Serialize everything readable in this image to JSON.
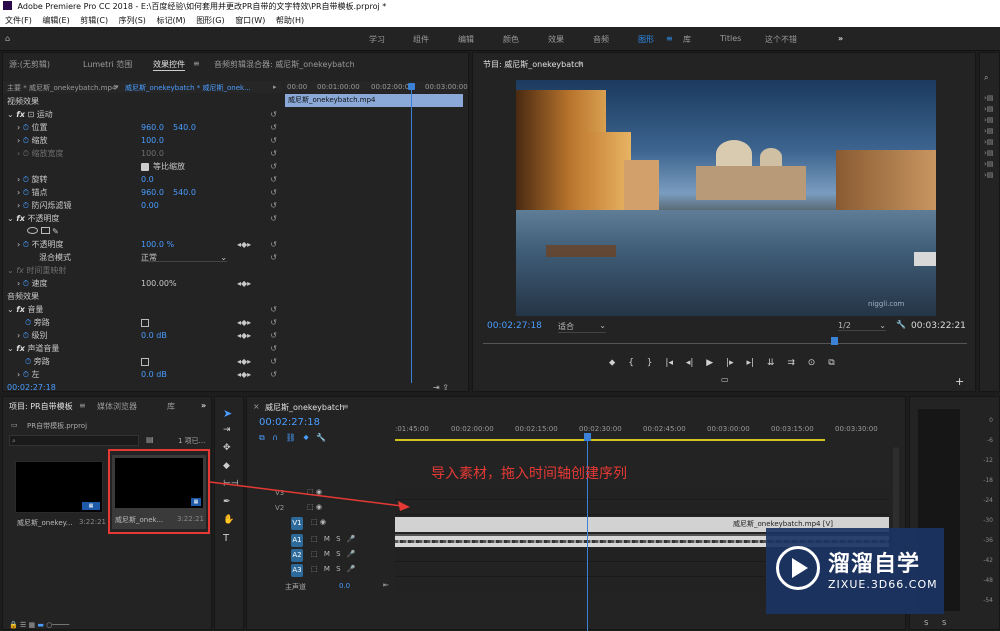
{
  "app": {
    "title": "Adobe Premiere Pro CC 2018 - E:\\百度经验\\如何套用并更改PR自带的文字特效\\PR自带模板.prproj *"
  },
  "menu": [
    "文件(F)",
    "编辑(E)",
    "剪辑(C)",
    "序列(S)",
    "标记(M)",
    "图形(G)",
    "窗口(W)",
    "帮助(H)"
  ],
  "workspaces": [
    {
      "label": "学习",
      "active": false
    },
    {
      "label": "组件",
      "active": false
    },
    {
      "label": "编辑",
      "active": false
    },
    {
      "label": "颜色",
      "active": false
    },
    {
      "label": "效果",
      "active": false
    },
    {
      "label": "音频",
      "active": false
    },
    {
      "label": "图形",
      "active": true
    },
    {
      "label": "库",
      "active": false
    },
    {
      "label": "Titles",
      "active": false
    },
    {
      "label": "这个不错",
      "active": false
    }
  ],
  "ws_more": "»",
  "source_panel": {
    "tabs": {
      "source": "源:(无剪辑)",
      "lumetri": "Lumetri 范围",
      "effect_controls": "效果控件",
      "audio_mixer": "音频剪辑混合器: 威尼斯_onekeybatch"
    },
    "master": "主要 * 威尼斯_onekeybatch.mp4",
    "seq": "威尼斯_onekeybatch * 威尼斯_onek...",
    "ruler": [
      "00:00",
      "00:01:00:00",
      "00:02:00:00",
      "00:03:00:00"
    ],
    "clip": "威尼斯_onekeybatch.mp4",
    "video_effects": "视频效果",
    "motion": "运动",
    "position": "位置",
    "pos_x": "960.0",
    "pos_y": "540.0",
    "scale": "缩放",
    "scale_val": "100.0",
    "scale_w": "缩放宽度",
    "scale_w_val": "100.0",
    "uniform": "等比缩放",
    "rotation": "旋转",
    "rotation_val": "0.0",
    "anchor": "锚点",
    "anchor_x": "960.0",
    "anchor_y": "540.0",
    "flicker": "防闪烁滤镜",
    "flicker_val": "0.00",
    "opacity_group": "不透明度",
    "opacity": "不透明度",
    "opacity_val": "100.0 %",
    "blend": "混合模式",
    "blend_val": "正常",
    "time_remap": "时间重映射",
    "speed": "速度",
    "speed_val": "100.00%",
    "audio_effects": "音频效果",
    "volume": "音量",
    "bypass": "旁路",
    "level": "级别",
    "level_val": "0.0 dB",
    "channel_volume": "声道音量",
    "bypass2": "旁路",
    "left": "左",
    "left_val": "0.0 dB",
    "timecode": "00:02:27:18"
  },
  "program": {
    "title": "节目: 威尼斯_onekeybatch",
    "timecode": "00:02:27:18",
    "fit": "适合",
    "res": "1/2",
    "duration": "00:03:22:21",
    "watermark": "niggli.com"
  },
  "project": {
    "tabs": {
      "project": "项目: PR自带模板",
      "media": "媒体浏览器",
      "library": "库"
    },
    "file": "PR自带模板.prproj",
    "count": "1 项已...",
    "items": [
      {
        "name": "威尼斯_onekey...",
        "dur": "3:22:21"
      },
      {
        "name": "威尼斯_onek...",
        "dur": "3:22:21"
      }
    ]
  },
  "timeline": {
    "tab": "威尼斯_onekeybatch",
    "timecode": "00:02:27:18",
    "ruler": [
      ":01:45:00",
      "00:02:00:00",
      "00:02:15:00",
      "00:02:30:00",
      "00:02:45:00",
      "00:03:00:00",
      "00:03:15:00",
      "00:03:30:00"
    ],
    "tracks": {
      "v3": "V3",
      "v2": "V2",
      "v1": "V1",
      "a1": "A1",
      "a2": "A2",
      "a3": "A3"
    },
    "master": "主声道",
    "master_val": "0.0",
    "clip": "威尼斯_onekeybatch.mp4 [V]",
    "annotation": "导入素材，拖入时间轴创建序列"
  },
  "meter": {
    "ticks": [
      "0",
      "-6",
      "-12",
      "-18",
      "-24",
      "-30",
      "-36",
      "-42",
      "-48",
      "-54"
    ],
    "labels": [
      "S",
      "S"
    ]
  },
  "watermark": {
    "brand": "溜溜自学",
    "url": "ZIXUE.3D66.COM"
  },
  "colors": {
    "accent": "#2d8ceb",
    "annotation": "#e53935",
    "track_btn": "#2d6a9a"
  }
}
